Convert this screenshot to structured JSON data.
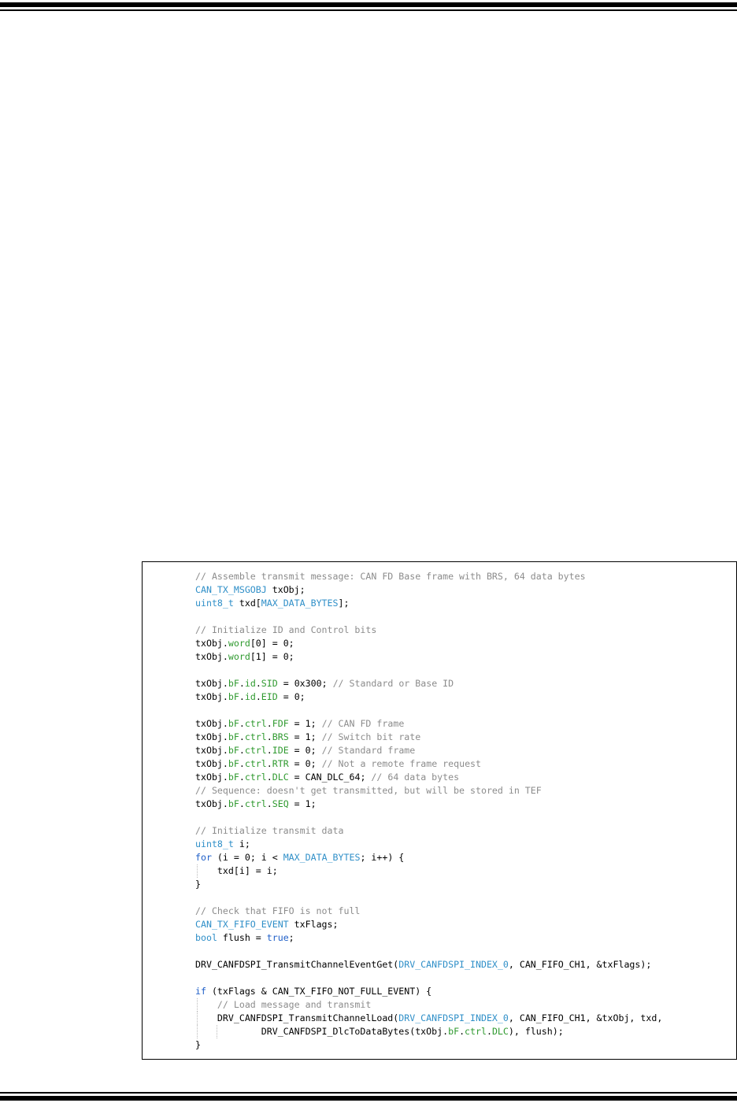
{
  "code_lines": [
    [
      {
        "c": "cmt",
        "t": "// Assemble transmit message: CAN FD Base frame with BRS, 64 data bytes"
      }
    ],
    [
      {
        "c": "typ",
        "t": "CAN_TX_MSGOBJ"
      },
      {
        "c": "",
        "t": " txObj;"
      }
    ],
    [
      {
        "c": "typ",
        "t": "uint8_t"
      },
      {
        "c": "",
        "t": " txd["
      },
      {
        "c": "typ",
        "t": "MAX_DATA_BYTES"
      },
      {
        "c": "",
        "t": "];"
      }
    ],
    [],
    [
      {
        "c": "cmt",
        "t": "// Initialize ID and Control bits"
      }
    ],
    [
      {
        "c": "",
        "t": "txObj."
      },
      {
        "c": "mem",
        "t": "word"
      },
      {
        "c": "",
        "t": "[0] = 0;"
      }
    ],
    [
      {
        "c": "",
        "t": "txObj."
      },
      {
        "c": "mem",
        "t": "word"
      },
      {
        "c": "",
        "t": "[1] = 0;"
      }
    ],
    [],
    [
      {
        "c": "",
        "t": "txObj."
      },
      {
        "c": "mem",
        "t": "bF"
      },
      {
        "c": "",
        "t": "."
      },
      {
        "c": "mem",
        "t": "id"
      },
      {
        "c": "",
        "t": "."
      },
      {
        "c": "mem",
        "t": "SID"
      },
      {
        "c": "",
        "t": " = 0x300; "
      },
      {
        "c": "cmt",
        "t": "// Standard or Base ID"
      }
    ],
    [
      {
        "c": "",
        "t": "txObj."
      },
      {
        "c": "mem",
        "t": "bF"
      },
      {
        "c": "",
        "t": "."
      },
      {
        "c": "mem",
        "t": "id"
      },
      {
        "c": "",
        "t": "."
      },
      {
        "c": "mem",
        "t": "EID"
      },
      {
        "c": "",
        "t": " = 0;"
      }
    ],
    [],
    [
      {
        "c": "",
        "t": "txObj."
      },
      {
        "c": "mem",
        "t": "bF"
      },
      {
        "c": "",
        "t": "."
      },
      {
        "c": "mem",
        "t": "ctrl"
      },
      {
        "c": "",
        "t": "."
      },
      {
        "c": "mem",
        "t": "FDF"
      },
      {
        "c": "",
        "t": " = 1; "
      },
      {
        "c": "cmt",
        "t": "// CAN FD frame"
      }
    ],
    [
      {
        "c": "",
        "t": "txObj."
      },
      {
        "c": "mem",
        "t": "bF"
      },
      {
        "c": "",
        "t": "."
      },
      {
        "c": "mem",
        "t": "ctrl"
      },
      {
        "c": "",
        "t": "."
      },
      {
        "c": "mem",
        "t": "BRS"
      },
      {
        "c": "",
        "t": " = 1; "
      },
      {
        "c": "cmt",
        "t": "// Switch bit rate"
      }
    ],
    [
      {
        "c": "",
        "t": "txObj."
      },
      {
        "c": "mem",
        "t": "bF"
      },
      {
        "c": "",
        "t": "."
      },
      {
        "c": "mem",
        "t": "ctrl"
      },
      {
        "c": "",
        "t": "."
      },
      {
        "c": "mem",
        "t": "IDE"
      },
      {
        "c": "",
        "t": " = 0; "
      },
      {
        "c": "cmt",
        "t": "// Standard frame"
      }
    ],
    [
      {
        "c": "",
        "t": "txObj."
      },
      {
        "c": "mem",
        "t": "bF"
      },
      {
        "c": "",
        "t": "."
      },
      {
        "c": "mem",
        "t": "ctrl"
      },
      {
        "c": "",
        "t": "."
      },
      {
        "c": "mem",
        "t": "RTR"
      },
      {
        "c": "",
        "t": " = 0; "
      },
      {
        "c": "cmt",
        "t": "// Not a remote frame request"
      }
    ],
    [
      {
        "c": "",
        "t": "txObj."
      },
      {
        "c": "mem",
        "t": "bF"
      },
      {
        "c": "",
        "t": "."
      },
      {
        "c": "mem",
        "t": "ctrl"
      },
      {
        "c": "",
        "t": "."
      },
      {
        "c": "mem",
        "t": "DLC"
      },
      {
        "c": "",
        "t": " = CAN_DLC_64; "
      },
      {
        "c": "cmt",
        "t": "// 64 data bytes"
      }
    ],
    [
      {
        "c": "cmt",
        "t": "// Sequence: doesn't get transmitted, but will be stored in TEF"
      }
    ],
    [
      {
        "c": "",
        "t": "txObj."
      },
      {
        "c": "mem",
        "t": "bF"
      },
      {
        "c": "",
        "t": "."
      },
      {
        "c": "mem",
        "t": "ctrl"
      },
      {
        "c": "",
        "t": "."
      },
      {
        "c": "mem",
        "t": "SEQ"
      },
      {
        "c": "",
        "t": " = 1;"
      }
    ],
    [],
    [
      {
        "c": "cmt",
        "t": "// Initialize transmit data"
      }
    ],
    [
      {
        "c": "typ",
        "t": "uint8_t"
      },
      {
        "c": "",
        "t": " i;"
      }
    ],
    [
      {
        "c": "kw",
        "t": "for"
      },
      {
        "c": "",
        "t": " (i = 0; i < "
      },
      {
        "c": "typ",
        "t": "MAX_DATA_BYTES"
      },
      {
        "c": "",
        "t": "; i++) {"
      }
    ],
    [
      {
        "c": "",
        "t": "    txd[i] = i;"
      }
    ],
    [
      {
        "c": "",
        "t": "}"
      }
    ],
    [],
    [
      {
        "c": "cmt",
        "t": "// Check that FIFO is not full"
      }
    ],
    [
      {
        "c": "typ",
        "t": "CAN_TX_FIFO_EVENT"
      },
      {
        "c": "",
        "t": " txFlags;"
      }
    ],
    [
      {
        "c": "typ",
        "t": "bool"
      },
      {
        "c": "",
        "t": " flush = "
      },
      {
        "c": "kw",
        "t": "true"
      },
      {
        "c": "",
        "t": ";"
      }
    ],
    [],
    [
      {
        "c": "",
        "t": "DRV_CANFDSPI_TransmitChannelEventGet("
      },
      {
        "c": "typ",
        "t": "DRV_CANFDSPI_INDEX_0"
      },
      {
        "c": "",
        "t": ", CAN_FIFO_CH1, &txFlags);"
      }
    ],
    [],
    [
      {
        "c": "kw",
        "t": "if"
      },
      {
        "c": "",
        "t": " (txFlags & CAN_TX_FIFO_NOT_FULL_EVENT) {"
      }
    ],
    [
      {
        "c": "",
        "t": "    "
      },
      {
        "c": "cmt",
        "t": "// Load message and transmit"
      }
    ],
    [
      {
        "c": "",
        "t": "    DRV_CANFDSPI_TransmitChannelLoad("
      },
      {
        "c": "typ",
        "t": "DRV_CANFDSPI_INDEX_0"
      },
      {
        "c": "",
        "t": ", CAN_FIFO_CH1, &txObj, txd,"
      }
    ],
    [
      {
        "c": "",
        "t": "            DRV_CANFDSPI_DlcToDataBytes(txObj."
      },
      {
        "c": "mem",
        "t": "bF"
      },
      {
        "c": "",
        "t": "."
      },
      {
        "c": "mem",
        "t": "ctrl"
      },
      {
        "c": "",
        "t": "."
      },
      {
        "c": "mem",
        "t": "DLC"
      },
      {
        "c": "",
        "t": "), flush);"
      }
    ],
    [
      {
        "c": "",
        "t": "}"
      }
    ]
  ]
}
